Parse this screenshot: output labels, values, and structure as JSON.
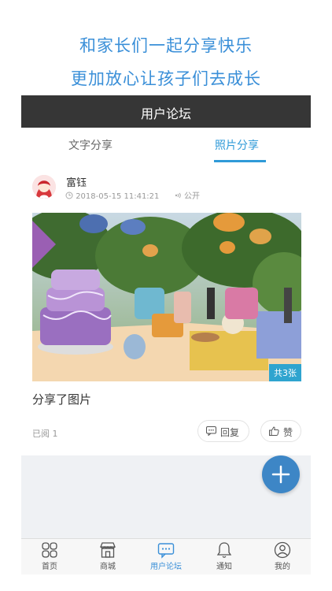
{
  "promo": {
    "line1": "和家长们一起分享快乐",
    "line2": "更加放心让孩子们去成长"
  },
  "header": {
    "title": "用户论坛"
  },
  "tabs": [
    {
      "label": "文字分享",
      "active": false
    },
    {
      "label": "照片分享",
      "active": true
    }
  ],
  "post": {
    "username": "富钰",
    "timestamp": "2018-05-15 11:41:21",
    "visibility": "公开",
    "image_count_label": "共3张",
    "text": "分享了图片",
    "read_label": "已阅 1",
    "reply_label": "回复",
    "like_label": "赞"
  },
  "bottom_nav": [
    {
      "label": "首页",
      "icon": "home-grid-icon"
    },
    {
      "label": "商城",
      "icon": "shop-icon"
    },
    {
      "label": "用户论坛",
      "icon": "forum-icon",
      "active": true
    },
    {
      "label": "通知",
      "icon": "bell-icon"
    },
    {
      "label": "我的",
      "icon": "user-icon"
    }
  ],
  "colors": {
    "accent": "#2f9ad8",
    "title_bar": "#363636",
    "fab": "#3d86c6"
  }
}
